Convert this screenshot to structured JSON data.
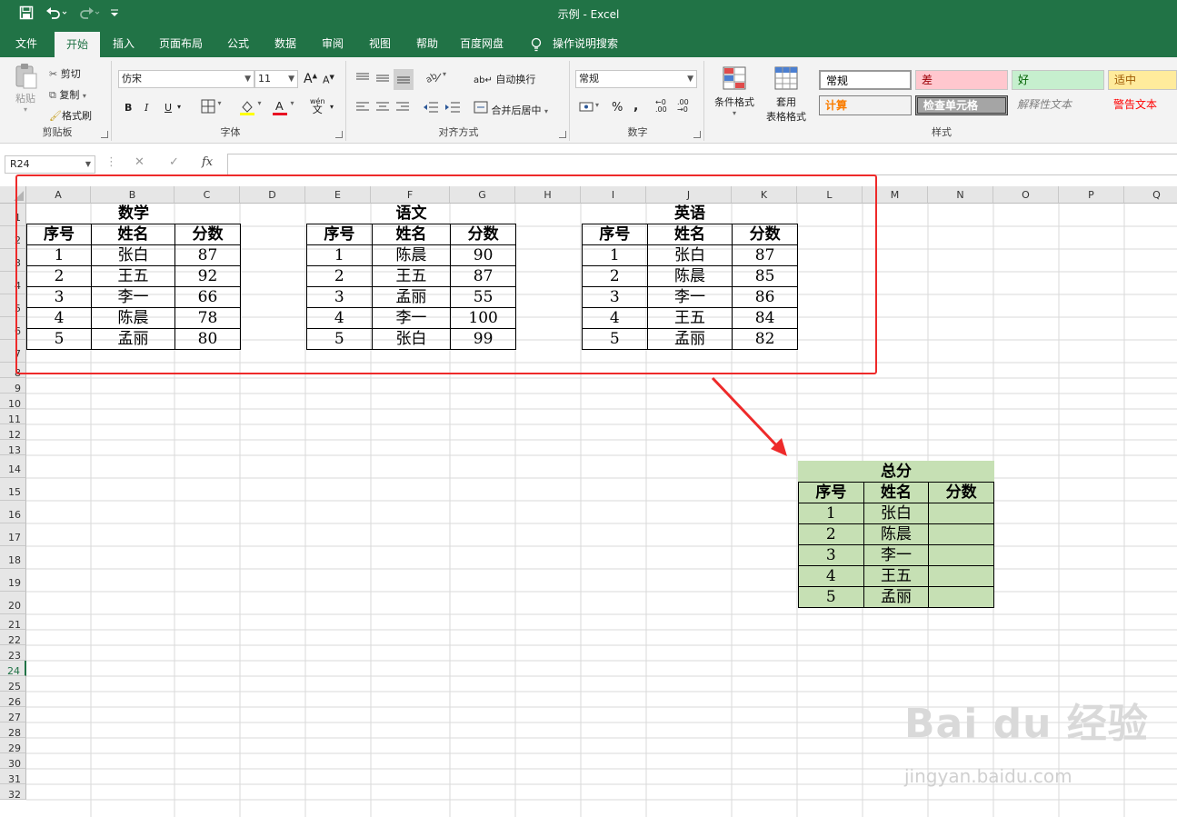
{
  "titlebar": {
    "title": "示例  -  Excel",
    "save_icon": "save-icon",
    "undo_icon": "undo-icon",
    "redo_icon": "redo-icon",
    "customize_icon": "customize-qat-icon"
  },
  "tabs": [
    {
      "label": "文件"
    },
    {
      "label": "开始"
    },
    {
      "label": "插入"
    },
    {
      "label": "页面布局"
    },
    {
      "label": "公式"
    },
    {
      "label": "数据"
    },
    {
      "label": "审阅"
    },
    {
      "label": "视图"
    },
    {
      "label": "帮助"
    },
    {
      "label": "百度网盘"
    },
    {
      "label": "操作说明搜索"
    }
  ],
  "ribbon": {
    "clipboard": {
      "paste": "粘贴",
      "cut": "剪切",
      "copy": "复制",
      "format_painter": "格式刷",
      "label": "剪贴板"
    },
    "font": {
      "name": "仿宋",
      "size": "11",
      "bold": "B",
      "italic": "I",
      "underline": "U",
      "grow": "A",
      "shrink": "A",
      "phonetic": "wén",
      "phonetic_char": "文",
      "label": "字体",
      "font_color": "#e81123",
      "fill_color": "#ffff00"
    },
    "alignment": {
      "wrap": "自动换行",
      "merge": "合并后居中",
      "label": "对齐方式"
    },
    "number": {
      "format": "常规",
      "percent": "%",
      "comma": ",",
      "label": "数字"
    },
    "styles": {
      "conditional": "条件格式",
      "table_line1": "套用",
      "table_line2": "表格格式",
      "cells": [
        {
          "text": "常规",
          "bg": "#ffffff",
          "color": "#000000"
        },
        {
          "text": "差",
          "bg": "#ffc7ce",
          "color": "#9c0006"
        },
        {
          "text": "好",
          "bg": "#c6efce",
          "color": "#006100"
        },
        {
          "text": "适中",
          "bg": "#ffeb9c",
          "color": "#9c5700"
        },
        {
          "text": "计算",
          "bg": "#f2f2f2",
          "color": "#fa7d00"
        },
        {
          "text": "检查单元格",
          "bg": "#a5a5a5",
          "color": "#ffffff"
        },
        {
          "text": "解释性文本",
          "bg": "#f3f3f3",
          "color": "#7f7f7f"
        },
        {
          "text": "警告文本",
          "bg": "#f3f3f3",
          "color": "#ff0000"
        }
      ],
      "label": "样式"
    }
  },
  "formula_bar": {
    "name_box": "R24",
    "cancel": "✕",
    "enter": "✓",
    "fx": "fx",
    "value": ""
  },
  "columns": [
    "A",
    "B",
    "C",
    "D",
    "E",
    "F",
    "G",
    "H",
    "I",
    "J",
    "K",
    "L",
    "M",
    "N",
    "O",
    "P",
    "Q"
  ],
  "rows": [
    "1",
    "2",
    "3",
    "4",
    "5",
    "6",
    "7",
    "8",
    "9",
    "10",
    "11",
    "12",
    "13",
    "14",
    "15",
    "16",
    "17",
    "18",
    "19",
    "20",
    "21",
    "22",
    "23",
    "24",
    "25",
    "26",
    "27",
    "28",
    "29",
    "30",
    "31",
    "32"
  ],
  "selected_row": "24",
  "tables": {
    "math": {
      "title": "数学",
      "headers": [
        "序号",
        "姓名",
        "分数"
      ],
      "rows": [
        [
          "1",
          "张白",
          "87"
        ],
        [
          "2",
          "王五",
          "92"
        ],
        [
          "3",
          "李一",
          "66"
        ],
        [
          "4",
          "陈晨",
          "78"
        ],
        [
          "5",
          "孟丽",
          "80"
        ]
      ]
    },
    "chinese": {
      "title": "语文",
      "headers": [
        "序号",
        "姓名",
        "分数"
      ],
      "rows": [
        [
          "1",
          "陈晨",
          "90"
        ],
        [
          "2",
          "王五",
          "87"
        ],
        [
          "3",
          "孟丽",
          "55"
        ],
        [
          "4",
          "李一",
          "100"
        ],
        [
          "5",
          "张白",
          "99"
        ]
      ]
    },
    "english": {
      "title": "英语",
      "headers": [
        "序号",
        "姓名",
        "分数"
      ],
      "rows": [
        [
          "1",
          "张白",
          "87"
        ],
        [
          "2",
          "陈晨",
          "85"
        ],
        [
          "3",
          "李一",
          "86"
        ],
        [
          "4",
          "王五",
          "84"
        ],
        [
          "5",
          "孟丽",
          "82"
        ]
      ]
    },
    "total": {
      "title": "总分",
      "headers": [
        "序号",
        "姓名",
        "分数"
      ],
      "rows": [
        [
          "1",
          "张白",
          ""
        ],
        [
          "2",
          "陈晨",
          ""
        ],
        [
          "3",
          "李一",
          ""
        ],
        [
          "4",
          "王五",
          ""
        ],
        [
          "5",
          "孟丽",
          ""
        ]
      ]
    }
  },
  "annotation": {
    "box_color": "#ee2a2a",
    "arrow_color": "#ee2a2a"
  },
  "watermark": {
    "main": "Bai du 经验",
    "sub": "jingyan.baidu.com"
  }
}
